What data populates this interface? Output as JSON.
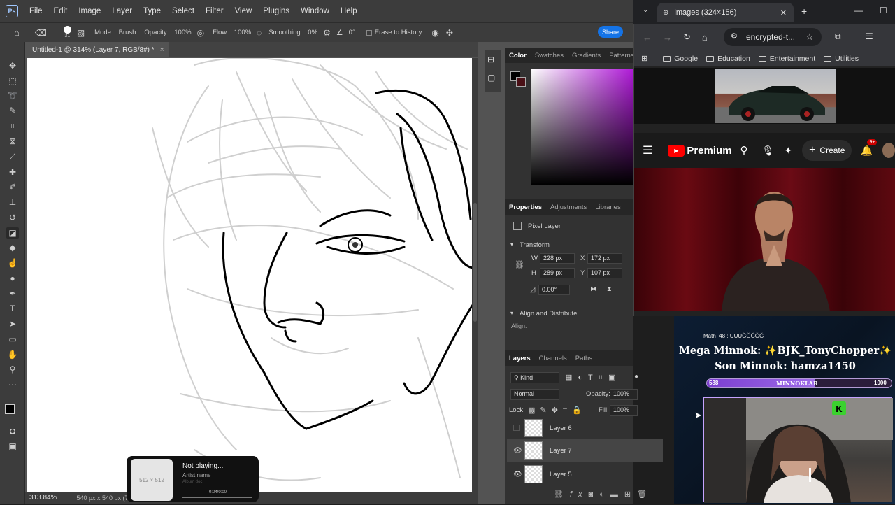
{
  "photoshop": {
    "menu": [
      "File",
      "Edit",
      "Image",
      "Layer",
      "Type",
      "Select",
      "Filter",
      "View",
      "Plugins",
      "Window",
      "Help"
    ],
    "options": {
      "brush_size": "31",
      "mode_label": "Mode:",
      "mode_value": "Brush",
      "opacity_label": "Opacity:",
      "opacity_value": "100%",
      "flow_label": "Flow:",
      "flow_value": "100%",
      "smoothing_label": "Smoothing:",
      "smoothing_value": "0%",
      "angle_value": "0°",
      "erase_history": "Erase to History",
      "share": "Share"
    },
    "doc_tab": "Untitled-1 @ 314% (Layer 7, RGB/8#) *",
    "status": {
      "zoom": "313.84%",
      "size": "540 px x 540 px (72 p"
    },
    "color_panel": {
      "tabs": [
        "Color",
        "Swatches",
        "Gradients",
        "Patterns"
      ]
    },
    "properties": {
      "tabs": [
        "Properties",
        "Adjustments",
        "Libraries"
      ],
      "layer_type": "Pixel Layer",
      "transform_label": "Transform",
      "w_label": "W",
      "w": "228 px",
      "h_label": "H",
      "h": "289 px",
      "x_label": "X",
      "x": "172 px",
      "y_label": "Y",
      "y": "107 px",
      "angle": "0.00°",
      "align_label": "Align and Distribute",
      "align_sub": "Align:"
    },
    "layers": {
      "tabs": [
        "Layers",
        "Channels",
        "Paths"
      ],
      "kind": "Kind",
      "blend": "Normal",
      "opacity_label": "Opacity:",
      "opacity": "100%",
      "lock_label": "Lock:",
      "fill_label": "Fill:",
      "fill": "100%",
      "items": [
        {
          "name": "Layer 6",
          "visible": false,
          "selected": false
        },
        {
          "name": "Layer 7",
          "visible": true,
          "selected": true
        },
        {
          "name": "Layer 5",
          "visible": true,
          "selected": false
        }
      ],
      "fx": "fx"
    },
    "media_popup": {
      "thumb": "512 × 512",
      "title": "Not playing...",
      "artist": "Artist name",
      "album": "Album doc",
      "time": "0:04/0:00"
    }
  },
  "browser": {
    "tab_title": "images (324×156)",
    "url": "encrypted-t...",
    "bookmarks": [
      "Google",
      "Education",
      "Entertainment",
      "Utilities"
    ],
    "youtube": {
      "brand": "Premium",
      "create": "Create",
      "badge": "9+"
    }
  },
  "stream_overlay": {
    "user_line": "Math_48 : UUUĞĞĞĞĞ",
    "mega": "Mega Minnok: ✨BJK_TonyChopper✨",
    "son": "Son Minnok: hamza1450",
    "bar_label": "MINNOKLAR",
    "bar_min": "588",
    "bar_max": "1000",
    "bar_fraction": 0.588,
    "cam_badge": "K"
  }
}
